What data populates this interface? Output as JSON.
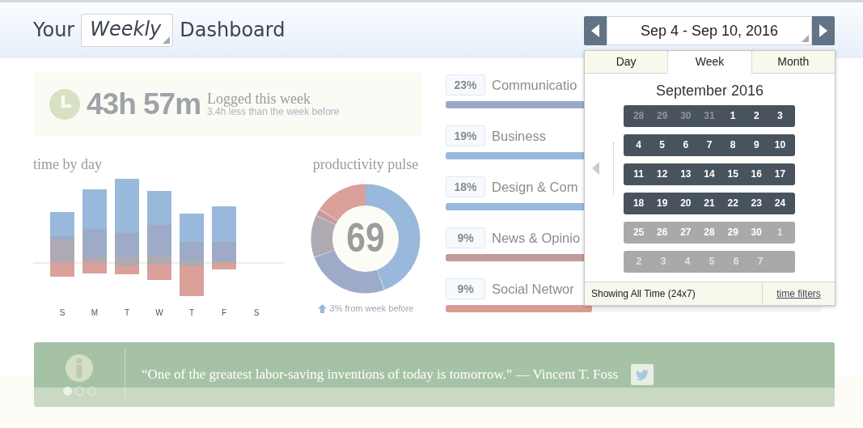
{
  "header": {
    "prefix": "Your",
    "period": "Weekly",
    "suffix": "Dashboard"
  },
  "date_range": {
    "label": "Sep 4 - Sep 10, 2016"
  },
  "summary": {
    "total": "43h 57m",
    "title": "Logged this week",
    "subtitle": "3.4h less than the week before"
  },
  "time_by_day": {
    "title": "time by day",
    "days": [
      "S",
      "M",
      "T",
      "W",
      "T",
      "F",
      "S"
    ]
  },
  "pulse": {
    "title": "productivity pulse",
    "score": "69",
    "change": "3% from week before"
  },
  "categories": [
    {
      "percent": "23%",
      "name": "Communicatio",
      "level": 1.0,
      "color": "#9aa9c8"
    },
    {
      "percent": "19%",
      "name": "Business",
      "level": 0.83,
      "color": "#98b9dc"
    },
    {
      "percent": "18%",
      "name": "Design & Com",
      "level": 0.78,
      "color": "#98b9dc"
    },
    {
      "percent": "9%",
      "name": "News & Opinio",
      "level": 0.39,
      "color": "#c29a98"
    },
    {
      "percent": "9%",
      "name": "Social Networ",
      "level": 0.39,
      "color": "#d99c95"
    }
  ],
  "calendar": {
    "tabs": [
      {
        "label": "Day",
        "selected": false
      },
      {
        "label": "Week",
        "selected": true
      },
      {
        "label": "Month",
        "selected": false
      }
    ],
    "month": "September 2016",
    "weeks": [
      {
        "active": true,
        "days": [
          {
            "label": "28",
            "other_month": true
          },
          {
            "label": "29",
            "other_month": true
          },
          {
            "label": "30",
            "other_month": true
          },
          {
            "label": "31",
            "other_month": true
          },
          {
            "label": "1",
            "other_month": false
          },
          {
            "label": "2",
            "other_month": false
          },
          {
            "label": "3",
            "other_month": false
          }
        ]
      },
      {
        "active": true,
        "days": [
          {
            "label": "4",
            "other_month": false
          },
          {
            "label": "5",
            "other_month": false
          },
          {
            "label": "6",
            "other_month": false
          },
          {
            "label": "7",
            "other_month": false
          },
          {
            "label": "8",
            "other_month": false
          },
          {
            "label": "9",
            "other_month": false
          },
          {
            "label": "10",
            "other_month": false
          }
        ]
      },
      {
        "active": true,
        "days": [
          {
            "label": "11",
            "other_month": false
          },
          {
            "label": "12",
            "other_month": false
          },
          {
            "label": "13",
            "other_month": false
          },
          {
            "label": "14",
            "other_month": false
          },
          {
            "label": "15",
            "other_month": false
          },
          {
            "label": "16",
            "other_month": false
          },
          {
            "label": "17",
            "other_month": false
          }
        ]
      },
      {
        "active": true,
        "days": [
          {
            "label": "18",
            "other_month": false
          },
          {
            "label": "19",
            "other_month": false
          },
          {
            "label": "20",
            "other_month": false
          },
          {
            "label": "21",
            "other_month": false
          },
          {
            "label": "22",
            "other_month": false
          },
          {
            "label": "23",
            "other_month": false
          },
          {
            "label": "24",
            "other_month": false
          }
        ]
      },
      {
        "active": false,
        "days": [
          {
            "label": "25",
            "other_month": false
          },
          {
            "label": "26",
            "other_month": false
          },
          {
            "label": "27",
            "other_month": false
          },
          {
            "label": "28",
            "other_month": false
          },
          {
            "label": "29",
            "other_month": false
          },
          {
            "label": "30",
            "other_month": false
          },
          {
            "label": "1",
            "other_month": true
          }
        ]
      },
      {
        "active": false,
        "days": [
          {
            "label": "2",
            "other_month": true
          },
          {
            "label": "3",
            "other_month": true
          },
          {
            "label": "4",
            "other_month": true
          },
          {
            "label": "5",
            "other_month": true
          },
          {
            "label": "6",
            "other_month": true
          },
          {
            "label": "7",
            "other_month": true
          }
        ]
      }
    ],
    "status": "Showing All Time (24x7)",
    "link": "time filters"
  },
  "quote": {
    "text": "“One of the greatest labor-saving inventions of today is tomorrow.” — Vincent T. Foss",
    "dots": [
      {
        "selected": true
      },
      {
        "selected": false
      },
      {
        "selected": false
      }
    ]
  }
}
